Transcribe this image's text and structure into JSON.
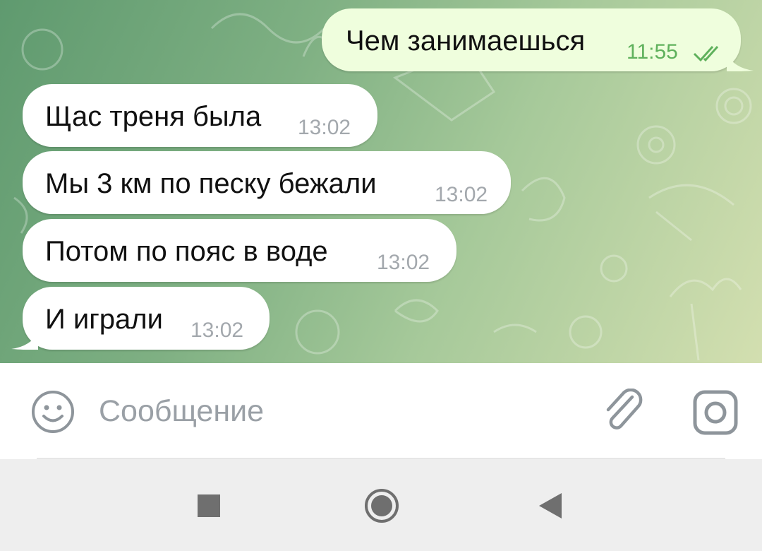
{
  "messages": [
    {
      "direction": "out",
      "text": "Чем занимаешься",
      "time": "11:55",
      "read": true
    },
    {
      "direction": "in",
      "text": "Щас треня была",
      "time": "13:02"
    },
    {
      "direction": "in",
      "text": "Мы 3 км по песку бежали",
      "time": "13:02"
    },
    {
      "direction": "in",
      "text": "Потом по пояс в воде",
      "time": "13:02"
    },
    {
      "direction": "in",
      "text": "И играли",
      "time": "13:02"
    }
  ],
  "composer": {
    "placeholder": "Сообщение",
    "emoji_icon": "smiley-icon",
    "attach_icon": "paperclip-icon",
    "camera_icon": "camera-icon"
  },
  "navbar": {
    "recents_icon": "square-icon",
    "home_icon": "circle-icon",
    "back_icon": "triangle-back-icon"
  },
  "colors": {
    "incoming_bubble": "#ffffff",
    "outgoing_bubble": "#effedd",
    "outgoing_time": "#5fb15c",
    "incoming_time": "#a3a8ad",
    "placeholder": "#9aa0a6"
  }
}
